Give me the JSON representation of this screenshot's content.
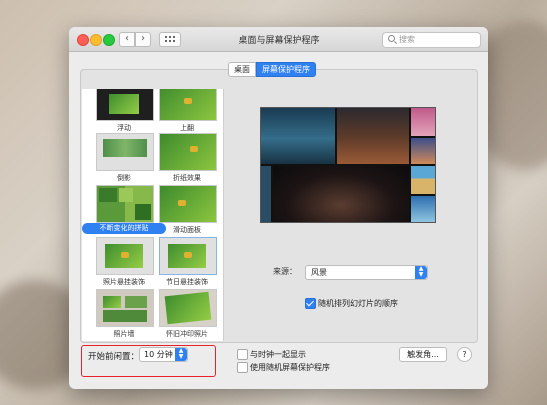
{
  "window": {
    "title": "桌面与屏幕保护程序"
  },
  "search": {
    "placeholder": "搜索"
  },
  "tabs": [
    {
      "label": "桌面",
      "selected": false
    },
    {
      "label": "屏幕保护程序",
      "selected": true
    }
  ],
  "screensavers": [
    {
      "label": "浮动",
      "selected": false
    },
    {
      "label": "上翻",
      "selected": false
    },
    {
      "label": "倒影",
      "selected": false
    },
    {
      "label": "折纸效果",
      "selected": false
    },
    {
      "label": "不断变化的拼贴",
      "selected": true
    },
    {
      "label": "滑动面板",
      "selected": false
    },
    {
      "label": "照片悬挂装饰",
      "selected": false
    },
    {
      "label": "节日悬挂装饰",
      "selected": false
    },
    {
      "label": "照片墙",
      "selected": false
    },
    {
      "label": "怀旧冲印照片",
      "selected": false
    }
  ],
  "options": {
    "source_label": "来源：",
    "source_value": "风景",
    "shuffle_label": "随机排列幻灯片的顺序",
    "shuffle_checked": true
  },
  "bottom": {
    "start_label": "开始前闲置：",
    "start_value": "10 分钟",
    "clock_label": "与时钟一起显示",
    "clock_checked": false,
    "random_label": "使用随机屏幕保护程序",
    "random_checked": false,
    "hot_corners_label": "触发角...",
    "help_label": "?"
  },
  "colors": {
    "accent": "#2f80f0",
    "highlight_box": "#e8222a"
  }
}
